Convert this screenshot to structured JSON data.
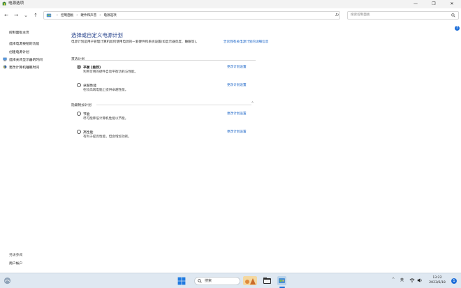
{
  "window": {
    "title": "电源选项",
    "controls": {
      "minimize": "—",
      "maximize": "❐",
      "close": "✕"
    }
  },
  "addressbar": {
    "breadcrumbs": [
      "控制面板",
      "硬件和声音",
      "电源选项"
    ],
    "separator": "›",
    "dropdown": "⌄",
    "refresh": "↻",
    "search_placeholder": "搜索控制面板"
  },
  "nav": {
    "back": "←",
    "forward": "→",
    "dropdown": "⌄",
    "up": "↑"
  },
  "help_icon": "?",
  "sidebar": {
    "home": "控制面板主页",
    "links": [
      "选择电源按钮的功能",
      "创建电源计划",
      "选择关闭显示器的时间",
      "更改计算机睡眠时间"
    ],
    "see_also_title": "另请参阅",
    "see_also": [
      "用户帐户"
    ]
  },
  "main": {
    "title": "选择或自定义电源计划",
    "description": "电源计划是用于管理计算机如何使用电源的一套硬件和系统设置(如显示器亮度、睡眠等)。",
    "description_link": "告诉我有关电源计划的详细信息",
    "preferred_section": "首选计划",
    "hidden_section": "隐藏附加计划",
    "collapse_icon": "⌃",
    "plans": [
      {
        "name": "平衡 (推荐)",
        "desc": "利用可用的硬件自动平衡功耗与性能。",
        "link": "更改计划设置",
        "selected": true
      },
      {
        "name": "卓越性能",
        "desc": "在较高端电脑上提供卓越性能。",
        "link": "更改计划设置",
        "selected": false
      },
      {
        "name": "节能",
        "desc": "尽可能降低计算机性能以节能。",
        "link": "更改计划设置",
        "selected": false
      },
      {
        "name": "高性能",
        "desc": "有利于提高性能，但会增加功耗。",
        "link": "更改计划设置",
        "selected": false
      }
    ]
  },
  "taskbar": {
    "search_label": "搜索",
    "tray": {
      "chevron": "^",
      "ime": "英"
    },
    "clock": {
      "time": "13:22",
      "date": "2023/6/18"
    },
    "notification_count": "1"
  },
  "colors": {
    "accent": "#1e6fd9",
    "link": "#1a64c7",
    "title": "#1f3c88"
  }
}
